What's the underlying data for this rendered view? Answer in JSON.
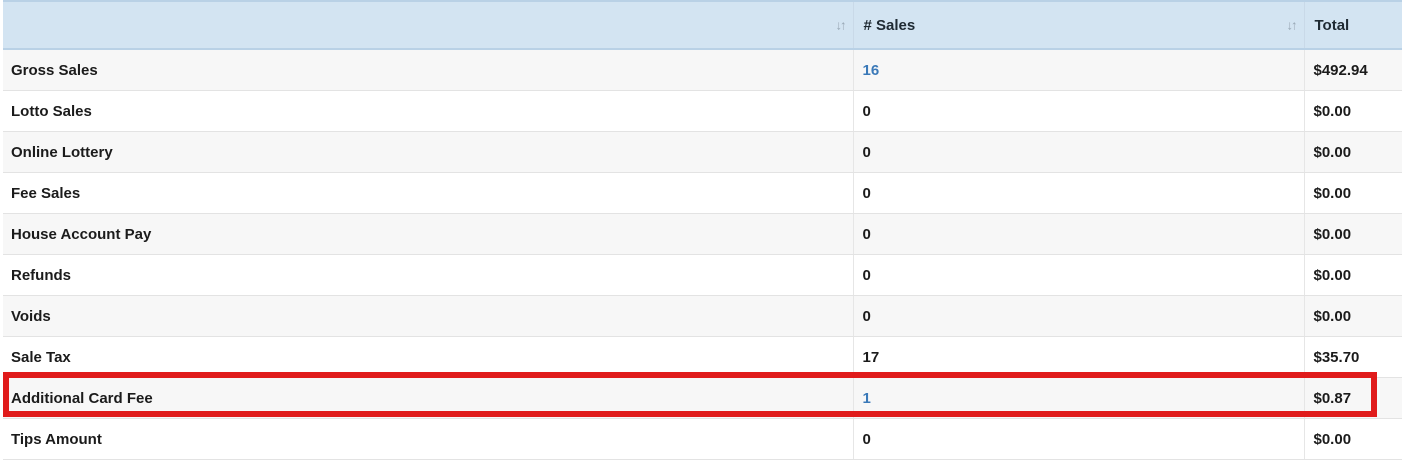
{
  "header": {
    "col1": "",
    "col2": "# Sales",
    "col3": "Total",
    "sort_glyph": "↓↑"
  },
  "rows": [
    {
      "label": "Gross Sales",
      "count": "16",
      "total": "$492.94",
      "count_is_link": true
    },
    {
      "label": "Lotto Sales",
      "count": "0",
      "total": "$0.00",
      "count_is_link": false
    },
    {
      "label": "Online Lottery",
      "count": "0",
      "total": "$0.00",
      "count_is_link": false
    },
    {
      "label": "Fee Sales",
      "count": "0",
      "total": "$0.00",
      "count_is_link": false
    },
    {
      "label": "House Account Pay",
      "count": "0",
      "total": "$0.00",
      "count_is_link": false
    },
    {
      "label": "Refunds",
      "count": "0",
      "total": "$0.00",
      "count_is_link": false
    },
    {
      "label": "Voids",
      "count": "0",
      "total": "$0.00",
      "count_is_link": false
    },
    {
      "label": "Sale Tax",
      "count": "17",
      "total": "$35.70",
      "count_is_link": false
    },
    {
      "label": "Additional Card Fee",
      "count": "1",
      "total": "$0.87",
      "count_is_link": true
    },
    {
      "label": "Tips Amount",
      "count": "0",
      "total": "$0.00",
      "count_is_link": false
    }
  ],
  "highlight": {
    "row_label": "Additional Card Fee",
    "color": "#e01b1b"
  },
  "colors": {
    "header_bg": "#d3e4f2",
    "link": "#3a79b8"
  }
}
